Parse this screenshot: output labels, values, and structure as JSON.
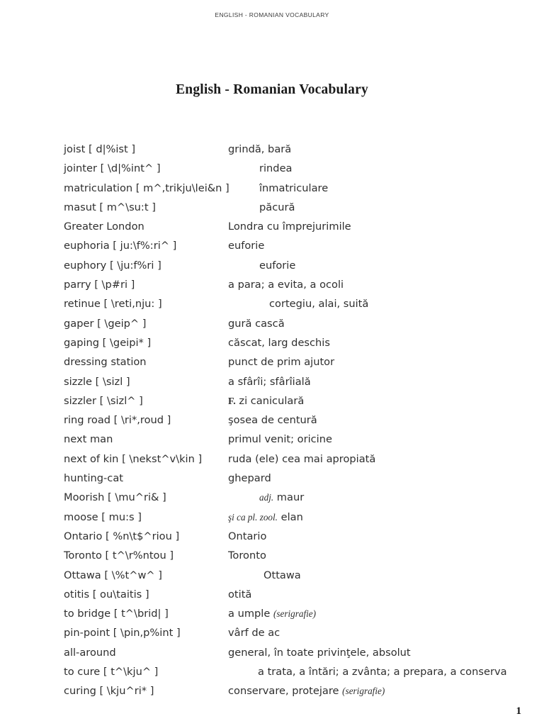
{
  "header": {
    "running_title": "ENGLISH - ROMANIAN VOCABULARY"
  },
  "title": "English - Romanian Vocabulary",
  "footer": {
    "page_number": "1"
  },
  "entries": [
    {
      "headword": "joist [ d|%ist ]",
      "indent": 0,
      "translation": "grindă, bară"
    },
    {
      "headword": "jointer [ \\d|%int^ ]",
      "indent": 44,
      "translation": "rindea"
    },
    {
      "headword": "matriculation [ m^,trikju\\lei&n ]",
      "indent": 44,
      "translation": "înmatriculare"
    },
    {
      "headword": "masut [ m^\\su:t ]",
      "indent": 44,
      "translation": "păcură"
    },
    {
      "headword": "Greater London",
      "indent": 0,
      "translation": "Londra cu împrejurimile"
    },
    {
      "headword": "euphoria [ ju:\\f%:ri^ ]",
      "indent": 0,
      "translation": "euforie"
    },
    {
      "headword": "euphory [ \\ju:f%ri ]",
      "indent": 44,
      "translation": "euforie"
    },
    {
      "headword": "parry [ \\p#ri ]",
      "indent": 0,
      "translation": "a para; a evita, a ocoli"
    },
    {
      "headword": "retinue [ \\reti,nju: ]",
      "indent": 58,
      "translation": "cortegiu, alai, suită"
    },
    {
      "headword": "gaper [ \\geip^ ]",
      "indent": 0,
      "translation": "gură cască"
    },
    {
      "headword": "gaping [ \\geipi* ]",
      "indent": 0,
      "translation": "căscat, larg deschis"
    },
    {
      "headword": "dressing station",
      "indent": 0,
      "translation": "punct de prim ajutor"
    },
    {
      "headword": "sizzle [ \\sizl ]",
      "indent": 0,
      "translation": "a sfârîi; sfârîială"
    },
    {
      "headword": "sizzler [ \\sizl^ ]",
      "indent": 0,
      "translation": "F. zi caniculară",
      "parts": [
        {
          "text": "F.",
          "style": "bold"
        },
        {
          "text": " zi caniculară",
          "style": "normal"
        }
      ]
    },
    {
      "headword": "ring road [ \\ri*,roud ]",
      "indent": 0,
      "translation": "şosea de centură"
    },
    {
      "headword": "next man",
      "indent": 0,
      "translation": "primul venit; oricine"
    },
    {
      "headword": "next of kin [ \\nekst^v\\kin ]",
      "indent": 0,
      "translation": "ruda (ele) cea mai apropiată"
    },
    {
      "headword": "hunting-cat",
      "indent": 0,
      "translation": "ghepard"
    },
    {
      "headword": "Moorish [ \\mu^ri& ]",
      "indent": 44,
      "translation": "adj. maur",
      "parts": [
        {
          "text": "adj.",
          "style": "italic"
        },
        {
          "text": " maur",
          "style": "normal"
        }
      ]
    },
    {
      "headword": "moose [ mu:s ]",
      "indent": 0,
      "translation": "şi ca pl. zool. elan",
      "parts": [
        {
          "text": "şi ca pl. zool.",
          "style": "italic"
        },
        {
          "text": " elan",
          "style": "normal"
        }
      ]
    },
    {
      "headword": "Ontario [ %n\\t$^riou ]",
      "indent": 0,
      "translation": "Ontario"
    },
    {
      "headword": "Toronto [ t^\\r%ntou ]",
      "indent": 0,
      "translation": "Toronto"
    },
    {
      "headword": "Ottawa [ \\%t^w^ ]",
      "indent": 50,
      "translation": "Ottawa"
    },
    {
      "headword": "otitis [ ou\\taitis ]",
      "indent": 0,
      "translation": "otită"
    },
    {
      "headword": "to bridge [ t^\\brid| ]",
      "indent": 0,
      "translation": "a umple (serigrafie)",
      "parts": [
        {
          "text": "a umple ",
          "style": "normal"
        },
        {
          "text": "(serigrafie)",
          "style": "italic"
        }
      ]
    },
    {
      "headword": "pin-point [ \\pin,p%int ]",
      "indent": 0,
      "translation": "vârf de ac"
    },
    {
      "headword": "all-around",
      "indent": 0,
      "translation": "general, în toate privinţele, absolut"
    },
    {
      "headword": "to cure [ t^\\kju^ ]",
      "indent": 42,
      "translation": "a trata, a întări; a zvânta; a prepara, a conserva"
    },
    {
      "headword": "curing [ \\kju^ri* ]",
      "indent": 0,
      "translation": "conservare, protejare (serigrafie)",
      "parts": [
        {
          "text": "conservare, protejare ",
          "style": "normal"
        },
        {
          "text": "(serigrafie)",
          "style": "italic"
        }
      ]
    }
  ]
}
